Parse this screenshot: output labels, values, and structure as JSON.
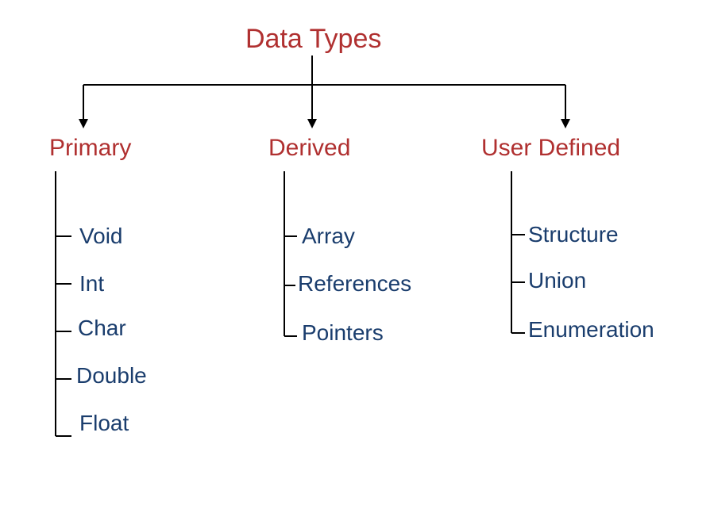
{
  "root": {
    "title": "Data Types"
  },
  "categories": [
    {
      "name": "Primary",
      "items": [
        "Void",
        "Int",
        "Char",
        "Double",
        "Float"
      ]
    },
    {
      "name": "Derived",
      "items": [
        "Array",
        "References",
        "Pointers"
      ]
    },
    {
      "name": "User Defined",
      "items": [
        "Structure",
        "Union",
        "Enumeration"
      ]
    }
  ],
  "colors": {
    "heading": "#b03030",
    "item": "#1a3d6d",
    "line": "#000000"
  }
}
